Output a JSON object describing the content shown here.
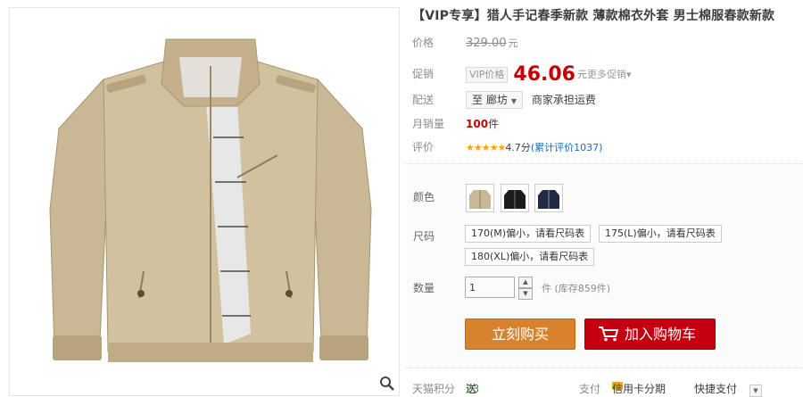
{
  "product": {
    "title": "【VIP专享】猎人手记春季新款 薄款棉衣外套 男士棉服春款新款"
  },
  "price": {
    "label": "价格",
    "original": "329.00",
    "unit": "元"
  },
  "promo": {
    "label": "促销",
    "tag": "VIP价格",
    "price": "46.06",
    "unit": "元",
    "more": "更多促销▾"
  },
  "delivery": {
    "label": "配送",
    "location": "至 廊坊",
    "note": "商家承担运费"
  },
  "monthly_sales": {
    "label": "月销量",
    "value": "100",
    "unit": "件"
  },
  "rating": {
    "label": "评价",
    "stars": "★★★★★",
    "score": "4.7分",
    "reviews": "(累计评价1037)"
  },
  "options": {
    "color_label": "颜色",
    "colors": [
      "khaki-jacket",
      "black-jacket",
      "navy-jacket"
    ],
    "size_label": "尺码",
    "sizes": [
      "170(M)偏小，请看尺码表",
      "175(L)偏小，请看尺码表",
      "180(XL)偏小，请看尺码表"
    ],
    "qty_label": "数量",
    "qty_value": "1",
    "qty_unit": "件",
    "stock": "(库存859件)"
  },
  "buttons": {
    "buy": "立刻购买",
    "cart": "加入购物车"
  },
  "footer": {
    "points_label": "天猫积分",
    "points_prefix": "送",
    "points_value": "23",
    "pay_label": "支付",
    "credit": "信用卡分期",
    "quick_pay": "快捷支付"
  },
  "colors": {
    "price_red": "#c40000",
    "buy_orange": "#d7832e",
    "cart_red": "#c40010"
  }
}
